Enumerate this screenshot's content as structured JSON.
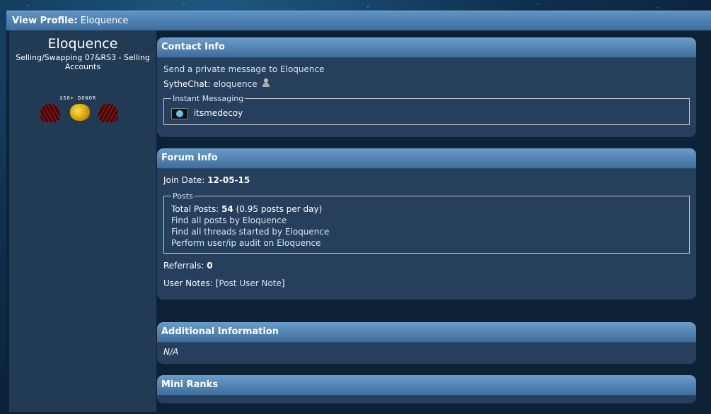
{
  "titlebar": {
    "label": "View Profile:",
    "name": "Eloquence"
  },
  "profile": {
    "username": "Eloquence",
    "user_title": "Selling/Swapping 07&RS3 - Selling Accounts",
    "rank_badge": {
      "text": "$50+ DONOR",
      "icons": [
        "claw-icon",
        "gold-coins-icon",
        "claw-icon"
      ]
    }
  },
  "contact_info": {
    "title": "Contact Info",
    "pm_link": "Send a private message to Eloquence",
    "sythechat_label": "SytheChat:",
    "sythechat_value": "eloquence",
    "im_legend": "Instant Messaging",
    "skype_name": "itsmedecoy"
  },
  "forum_info": {
    "title": "Forum Info",
    "join_label": "Join Date:",
    "join_value": "12-05-15",
    "posts_legend": "Posts",
    "total_posts_label": "Total Posts:",
    "total_posts_value": "54",
    "posts_per_day": "(0.95 posts per day)",
    "find_posts": "Find all posts by Eloquence",
    "find_threads": "Find all threads started by Eloquence",
    "audit": "Perform user/ip audit on Eloquence",
    "referrals_label": "Referrals:",
    "referrals_value": "0",
    "notes_label": "User Notes:",
    "notes_open": "[",
    "notes_link": "Post User Note",
    "notes_close": "]"
  },
  "additional_info": {
    "title": "Additional Information",
    "value": "N/A"
  },
  "mini_ranks": {
    "title": "Mini Ranks"
  },
  "colors": {
    "header_blue": "#4f81b1",
    "panel_bg": "#253f5d",
    "sidebar_bg": "#223b55"
  }
}
